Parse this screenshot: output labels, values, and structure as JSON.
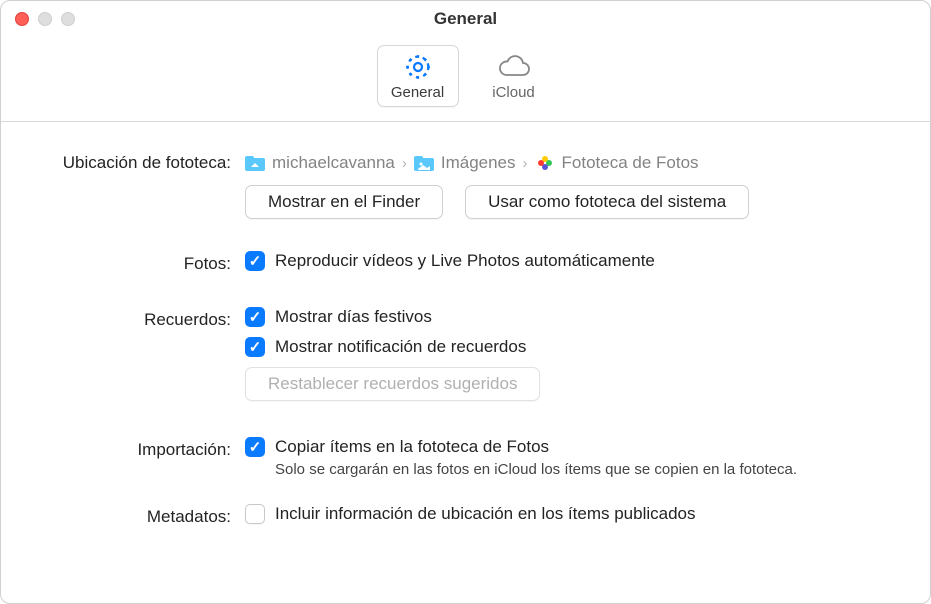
{
  "window": {
    "title": "General"
  },
  "toolbar": {
    "general": "General",
    "icloud": "iCloud"
  },
  "labels": {
    "location": "Ubicación de fototeca:",
    "photos": "Fotos:",
    "memories": "Recuerdos:",
    "import": "Importación:",
    "metadata": "Metadatos:"
  },
  "breadcrumb": {
    "seg1": "michaelcavanna",
    "seg2": "Imágenes",
    "seg3": "Fototeca de Fotos"
  },
  "buttons": {
    "show_finder": "Mostrar en el Finder",
    "use_system": "Usar como fototeca del sistema",
    "reset_memories": "Restablecer recuerdos sugeridos"
  },
  "checks": {
    "autoplay": "Reproducir vídeos y Live Photos automáticamente",
    "holidays": "Mostrar días festivos",
    "mem_notif": "Mostrar notificación de recuerdos",
    "copy_items": "Copiar ítems en la fototeca de Fotos",
    "copy_help": "Solo se cargarán en las fotos en iCloud los ítems que se copien en la fototeca.",
    "location_meta": "Incluir información de ubicación en los ítems publicados"
  },
  "colors": {
    "accent": "#0a7aff"
  }
}
